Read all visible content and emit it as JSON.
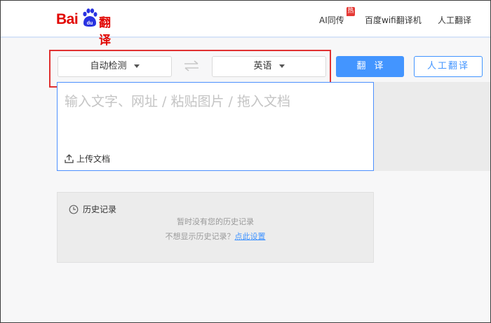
{
  "header": {
    "logo": {
      "bai": "Bai",
      "du": "du",
      "fanyi": "翻译"
    },
    "nav": [
      {
        "label": "AI同传",
        "badge": "热"
      },
      {
        "label": "百度wifi翻译机"
      },
      {
        "label": "人工翻译"
      }
    ]
  },
  "toolbar": {
    "source_lang": "自动检测",
    "target_lang": "英语",
    "translate_label": "翻译",
    "human_label": "人工翻译"
  },
  "input": {
    "placeholder": "输入文字、网址 / 粘贴图片 / 拖入文档",
    "upload_label": "上传文档"
  },
  "history": {
    "title": "历史记录",
    "empty": "暂时没有您的历史记录",
    "hint_prefix": "不想显示历史记录？",
    "hint_link": "点此设置"
  },
  "colors": {
    "brand_red": "#e10602",
    "accent_blue": "#4395ff",
    "highlight": "#e03131"
  }
}
